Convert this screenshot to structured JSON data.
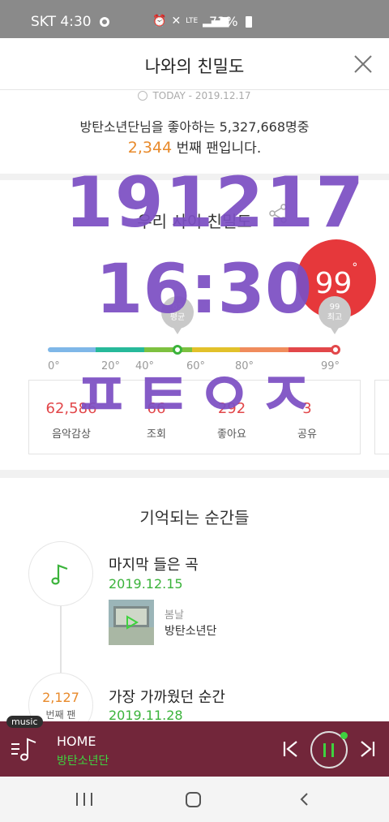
{
  "status_bar": {
    "carrier_time": "SKT 4:30",
    "network": "LTE",
    "battery": "73%"
  },
  "header": {
    "title": "나와의 친밀도",
    "close_icon": "close-icon"
  },
  "summary": {
    "today_label": "TODAY - 2019.12.17",
    "fans_line": "방탄소년단님을 좋아하는 5,327,668명중",
    "rank": "2,344",
    "rank_suffix": " 번째 팬입니다."
  },
  "intimacy": {
    "section_title": "우리 사이 친밀도",
    "score": "99",
    "degree_mark": "°",
    "avg_bubble": {
      "value": "63",
      "label": "평균"
    },
    "max_bubble": {
      "value": "99",
      "label": "최고"
    },
    "scale_labels": [
      "0°",
      "20°",
      "40°",
      "60°",
      "80°",
      "99°"
    ],
    "bar_colors": [
      "#7fb7e8",
      "#27b99a",
      "#7dc140",
      "#e2c12a",
      "#f08c5c",
      "#e2474a"
    ],
    "stats": [
      {
        "value": "62,586",
        "label": "음악감상"
      },
      {
        "value": "66",
        "label": "조회"
      },
      {
        "value": "292",
        "label": "좋아요"
      },
      {
        "value": "3",
        "label": "공유"
      }
    ]
  },
  "moments": {
    "title": "기억되는 순간들",
    "items": [
      {
        "title": "마지막 들은 곡",
        "date": "2019.12.15",
        "song": "봄날",
        "artist": "방탄소년단"
      },
      {
        "title": "가장 가까웠던 순간",
        "date": "2019.11.28",
        "rank": "2,127",
        "rank_label": "번째 팬"
      }
    ]
  },
  "overlay": {
    "line1": "191217",
    "line2": "16:30",
    "line3": "ㅍㅌㅇㅈ"
  },
  "player": {
    "tag": "music",
    "track": "HOME",
    "artist": "방탄소년단"
  }
}
